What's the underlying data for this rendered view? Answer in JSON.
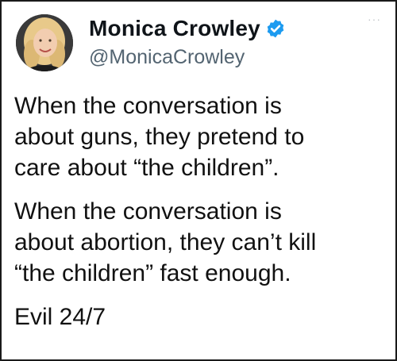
{
  "tweet": {
    "display_name": "Monica Crowley",
    "handle": "@MonicaCrowley",
    "verified": true,
    "more_menu": "···",
    "paragraphs": [
      "When the conversation is\nabout guns, they pretend to\ncare about “the children”.",
      "When the conversation is\nabout abortion, they can’t kill\n“the children” fast enough.",
      "Evil 24/7"
    ]
  },
  "icons": {
    "verified": "verified-badge-icon",
    "more": "more-options-icon"
  },
  "colors": {
    "verified_blue": "#1d9bf0",
    "text": "#111111",
    "handle": "#536471"
  }
}
